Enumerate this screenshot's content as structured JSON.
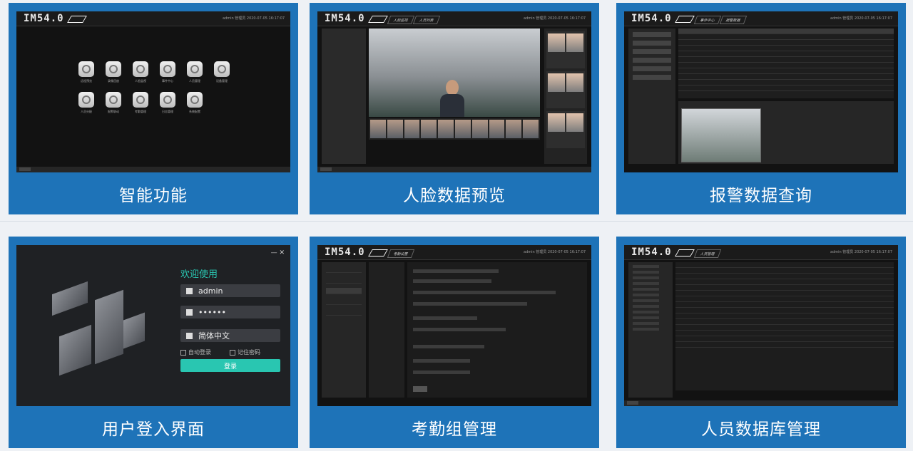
{
  "cards": [
    {
      "caption": "智能功能"
    },
    {
      "caption": "人脸数据预览"
    },
    {
      "caption": "报警数据查询"
    },
    {
      "caption": "用户登入界面"
    },
    {
      "caption": "考勤组管理"
    },
    {
      "caption": "人员数据库管理"
    }
  ],
  "app": {
    "logo": "IM54.0",
    "status": "admin  管理员  2020-07-05 16:17:07"
  },
  "preview_tabs": [
    "人脸监视",
    "人员列表"
  ],
  "alarm_tabs": [
    "事件中心",
    "报警数据"
  ],
  "attendance_tabs": [
    "考勤设置"
  ],
  "personnel_tabs": [
    "人员管理"
  ],
  "apps": [
    {
      "label": "远程预览"
    },
    {
      "label": "录像回放"
    },
    {
      "label": "人脸监视"
    },
    {
      "label": "事件中心"
    },
    {
      "label": "人员管理"
    },
    {
      "label": "设备管理"
    },
    {
      "label": "人员分配"
    },
    {
      "label": "报警联动"
    },
    {
      "label": "考勤管理"
    },
    {
      "label": "日志管理"
    },
    {
      "label": "系统配置"
    }
  ],
  "login": {
    "welcome": "欢迎使用",
    "username": "admin",
    "password": "••••••",
    "language": "简体中文",
    "auto_login": "自动登录",
    "remember_password": "记住密码",
    "submit": "登录",
    "min": "—",
    "close": "✕"
  },
  "colors": {
    "accent": "#1e73b8",
    "login_accent": "#29c6b1"
  }
}
